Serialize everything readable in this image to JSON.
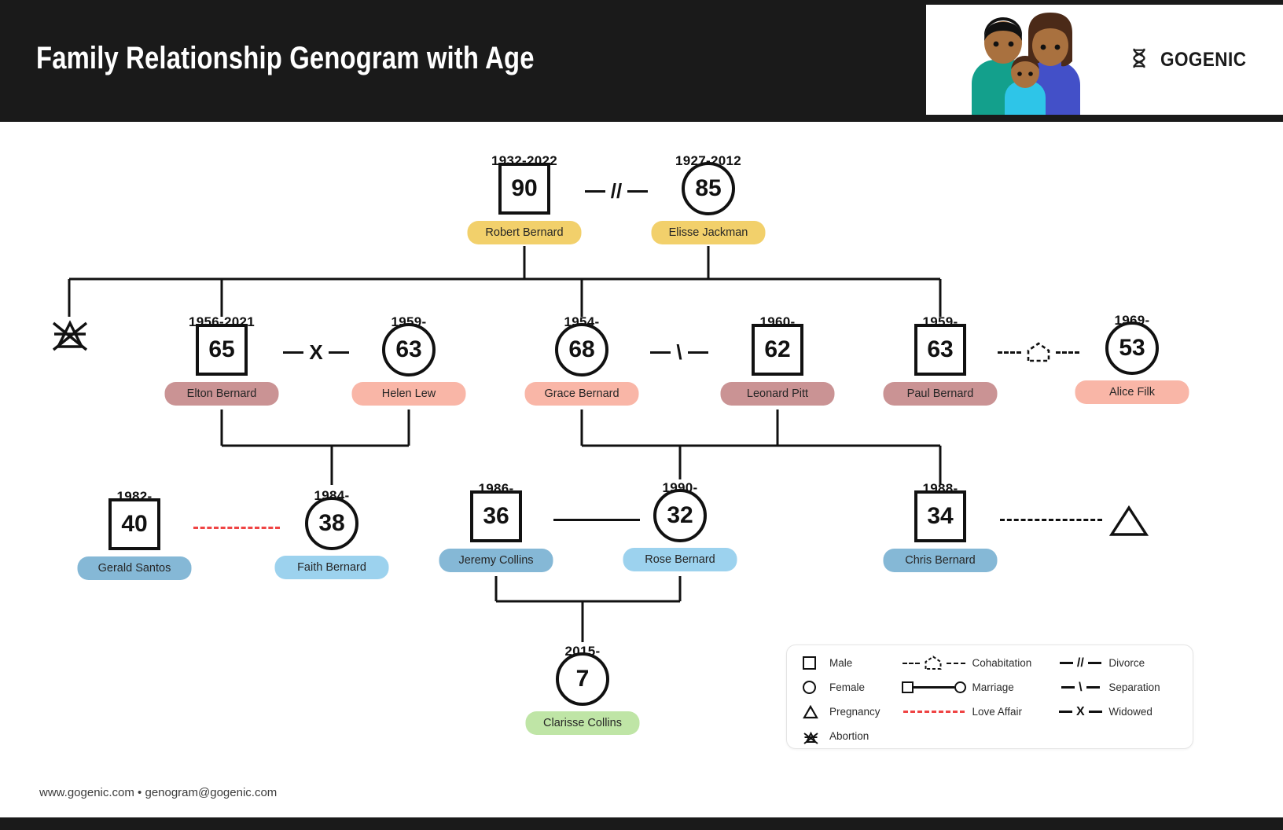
{
  "header": {
    "title": "Family Relationship Genogram with Age",
    "brand_name": "GOGENIC",
    "dna_icon": "dna-helix-icon",
    "illustration": "family-portrait-illustration"
  },
  "footer": {
    "text": "www.gogenic.com • genogram@gogenic.com"
  },
  "people": [
    {
      "id": "robert",
      "name": "Robert Bernard",
      "age": "90",
      "years": "1932-2022",
      "gender": "male",
      "shape": "square",
      "color": "#f2d06b"
    },
    {
      "id": "elisse",
      "name": "Elisse Jackman",
      "age": "85",
      "years": "1927-2012",
      "gender": "female",
      "shape": "circle",
      "color": "#f2d06b"
    },
    {
      "id": "elton",
      "name": "Elton Bernard",
      "age": "65",
      "years": "1956-2021",
      "gender": "male",
      "shape": "square",
      "color": "#ca9394"
    },
    {
      "id": "helen",
      "name": "Helen Lew",
      "age": "63",
      "years": "1959-",
      "gender": "female",
      "shape": "circle",
      "color": "#f9b6a7"
    },
    {
      "id": "grace",
      "name": "Grace Bernard",
      "age": "68",
      "years": "1954-",
      "gender": "female",
      "shape": "circle",
      "color": "#f9b6a7"
    },
    {
      "id": "leonard",
      "name": "Leonard Pitt",
      "age": "62",
      "years": "1960-",
      "gender": "male",
      "shape": "square",
      "color": "#ca9394"
    },
    {
      "id": "paul",
      "name": "Paul Bernard",
      "age": "63",
      "years": "1959-",
      "gender": "male",
      "shape": "square",
      "color": "#ca9394"
    },
    {
      "id": "alice",
      "name": "Alice Filk",
      "age": "53",
      "years": "1969-",
      "gender": "female",
      "shape": "circle",
      "color": "#f9b6a7"
    },
    {
      "id": "gerald",
      "name": "Gerald Santos",
      "age": "40",
      "years": "1982-",
      "gender": "male",
      "shape": "square",
      "color": "#85b8d6"
    },
    {
      "id": "faith",
      "name": "Faith Bernard",
      "age": "38",
      "years": "1984-",
      "gender": "female",
      "shape": "circle",
      "color": "#9cd2ee"
    },
    {
      "id": "jeremy",
      "name": "Jeremy Collins",
      "age": "36",
      "years": "1986-",
      "gender": "male",
      "shape": "square",
      "color": "#85b8d6"
    },
    {
      "id": "rose",
      "name": "Rose Bernard",
      "age": "32",
      "years": "1990-",
      "gender": "female",
      "shape": "circle",
      "color": "#9cd2ee"
    },
    {
      "id": "chris",
      "name": "Chris Bernard",
      "age": "34",
      "years": "1988-",
      "gender": "male",
      "shape": "square",
      "color": "#85b8d6"
    },
    {
      "id": "clarisse",
      "name": "Clarisse Collins",
      "age": "7",
      "years": "2015-",
      "gender": "female",
      "shape": "circle",
      "color": "#bfe5a6"
    }
  ],
  "relationships": [
    {
      "id": "robert-elisse",
      "type": "divorce",
      "glyph": "//"
    },
    {
      "id": "elton-helen",
      "type": "widowed",
      "glyph": "X"
    },
    {
      "id": "grace-leonard",
      "type": "separation",
      "glyph": "\\"
    },
    {
      "id": "paul-alice",
      "type": "cohabitation",
      "glyph": "house"
    },
    {
      "id": "gerald-faith",
      "type": "love-affair",
      "glyph": "red-dashed"
    },
    {
      "id": "jeremy-rose",
      "type": "marriage",
      "glyph": "solid"
    },
    {
      "id": "chris-pregnancy",
      "type": "pregnancy",
      "glyph": "black-dashed"
    }
  ],
  "standalone_symbols": [
    {
      "id": "abortion-symbol",
      "name": "abortion-symbol"
    },
    {
      "id": "pregnancy-symbol",
      "name": "pregnancy-triangle-symbol"
    }
  ],
  "legend": {
    "columns": [
      {
        "items": [
          {
            "icon": "male-square-icon",
            "label": "Male"
          },
          {
            "icon": "female-circle-icon",
            "label": "Female"
          },
          {
            "icon": "pregnancy-triangle-icon",
            "label": "Pregnancy"
          },
          {
            "icon": "abortion-icon",
            "label": "Abortion"
          }
        ]
      },
      {
        "items": [
          {
            "icon": "cohabitation-icon",
            "label": "Cohabitation"
          },
          {
            "icon": "marriage-icon",
            "label": "Marriage"
          },
          {
            "icon": "love-affair-icon",
            "label": "Love Affair"
          }
        ]
      },
      {
        "items": [
          {
            "icon": "divorce-icon",
            "label": "Divorce",
            "glyph": "//"
          },
          {
            "icon": "separation-icon",
            "label": "Separation",
            "glyph": "\\"
          },
          {
            "icon": "widowed-icon",
            "label": "Widowed",
            "glyph": "X"
          }
        ]
      }
    ]
  },
  "colors": {
    "header_bg": "#1a1a1a",
    "gold": "#f2d06b",
    "male_gen2": "#ca9394",
    "female_gen2": "#f9b6a7",
    "male_gen3": "#85b8d6",
    "female_gen3": "#9cd2ee",
    "child": "#bfe5a6",
    "love_affair": "#ef4444",
    "line": "#111111"
  }
}
